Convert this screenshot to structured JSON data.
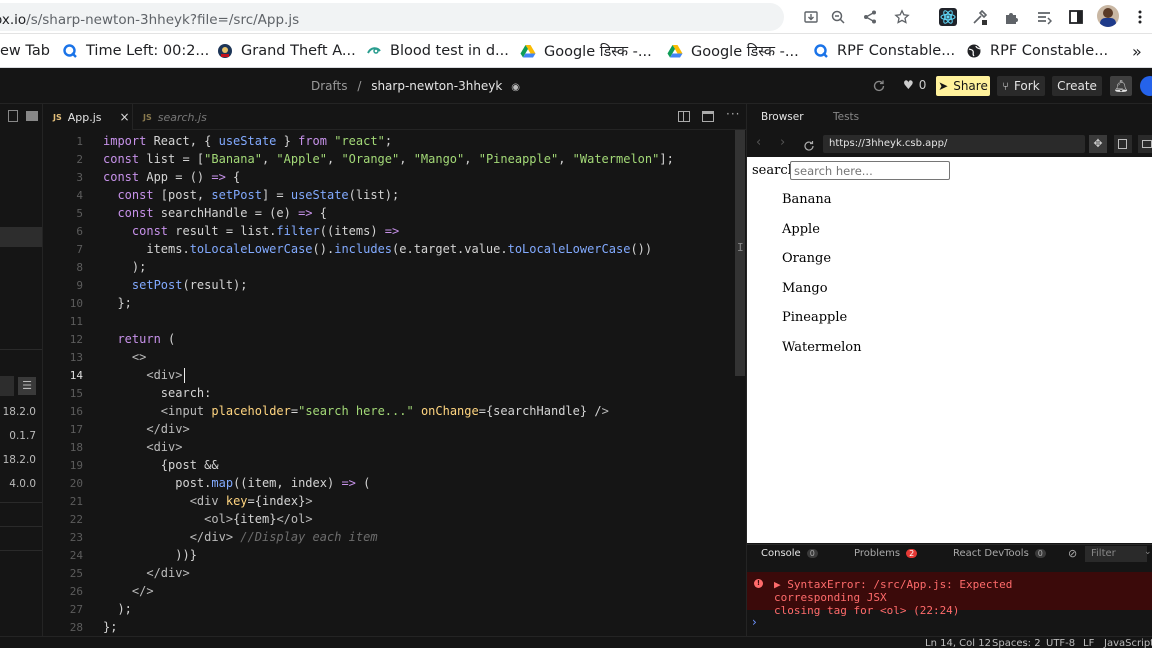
{
  "browser": {
    "url_host": "ox.io",
    "url_path": "/s/sharp-newton-3hheyk?file=/src/App.js"
  },
  "bookmarks": [
    {
      "label": "ew Tab"
    },
    {
      "label": "Time Left: 00:2..."
    },
    {
      "label": "Grand Theft A..."
    },
    {
      "label": "Blood test in d..."
    },
    {
      "label": "Google डिस्क -..."
    },
    {
      "label": "Google डिस्क -..."
    },
    {
      "label": "RPF Constable..."
    },
    {
      "label": "RPF Constable..."
    }
  ],
  "header": {
    "drafts": "Drafts",
    "separator": "/",
    "project": "sharp-newton-3hheyk",
    "likes": "0",
    "share": "Share",
    "fork": "Fork",
    "create": "Create"
  },
  "left": {
    "versions": [
      "18.2.0",
      "0.1.7",
      "18.2.0",
      "4.0.0"
    ]
  },
  "tabs": [
    {
      "label": "App.js",
      "close": "×"
    },
    {
      "label": "search.js"
    }
  ],
  "code": [
    "import React, { useState } from \"react\";",
    "const list = [\"Banana\", \"Apple\", \"Orange\", \"Mango\", \"Pineapple\", \"Watermelon\"];",
    "const App = () => {",
    "  const [post, setPost] = useState(list);",
    "  const searchHandle = (e) => {",
    "    const result = list.filter((items) =>",
    "      items.toLocaleLowerCase().includes(e.target.value.toLocaleLowerCase())",
    "    );",
    "    setPost(result);",
    "  };",
    "",
    "  return (",
    "    <>",
    "      <div>",
    "        search:",
    "        <input placeholder=\"search here...\" onChange={searchHandle} />",
    "      </div>",
    "      <div>",
    "        {post &&",
    "          post.map((item, index) => (",
    "            <div key={index}>",
    "              <ol>{item}</ol>",
    "            </div> //Display each item",
    "          ))}",
    "      </div>",
    "    </>",
    "  );",
    "};"
  ],
  "preview": {
    "tab_browser": "Browser",
    "tab_tests": "Tests",
    "url": "https://3hheyk.csb.app/",
    "search_label": "search:",
    "search_placeholder": "search here...",
    "items": [
      "Banana",
      "Apple",
      "Orange",
      "Mango",
      "Pineapple",
      "Watermelon"
    ]
  },
  "console": {
    "tab_console": "Console",
    "console_count": "0",
    "tab_problems": "Problems",
    "problems_count": "2",
    "tab_devtools": "React DevTools",
    "devtools_count": "0",
    "filter": "Filter",
    "error_line1": "▶ SyntaxError: /src/App.js: Expected corresponding JSX",
    "error_line2": "closing tag for <ol> (22:24)",
    "prompt": "›"
  },
  "status": {
    "position": "Ln 14, Col 12",
    "spaces": "Spaces: 2",
    "encoding": "UTF-8",
    "eol": "LF",
    "language": "JavaScript"
  },
  "colors": {
    "share_bg": "#fff29c",
    "error_bg": "#3b0a0a",
    "error_text": "#ff6b6b",
    "badge_red": "#e53935"
  }
}
